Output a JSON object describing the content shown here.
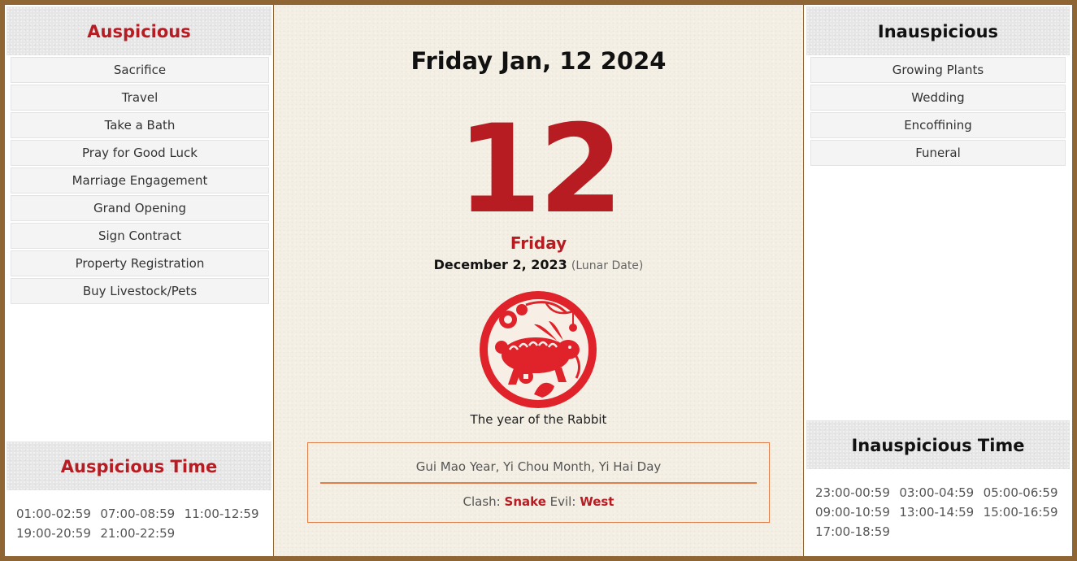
{
  "auspicious": {
    "title": "Auspicious",
    "items": [
      {
        "label": "Sacrifice"
      },
      {
        "label": "Travel"
      },
      {
        "label": "Take a Bath"
      },
      {
        "label": "Pray for Good Luck"
      },
      {
        "label": "Marriage Engagement"
      },
      {
        "label": "Grand Opening"
      },
      {
        "label": "Sign Contract"
      },
      {
        "label": "Property Registration"
      },
      {
        "label": "Buy Livestock/Pets"
      }
    ]
  },
  "auspicious_time": {
    "title": "Auspicious Time",
    "times": [
      "01:00-02:59",
      "07:00-08:59",
      "11:00-12:59",
      "19:00-20:59",
      "21:00-22:59"
    ]
  },
  "inauspicious": {
    "title": "Inauspicious",
    "items": [
      {
        "label": "Growing Plants"
      },
      {
        "label": "Wedding"
      },
      {
        "label": "Encoffining"
      },
      {
        "label": "Funeral"
      }
    ]
  },
  "inauspicious_time": {
    "title": "Inauspicious Time",
    "times": [
      "23:00-00:59",
      "03:00-04:59",
      "05:00-06:59",
      "09:00-10:59",
      "13:00-14:59",
      "15:00-16:59",
      "17:00-18:59"
    ]
  },
  "main": {
    "title": "Friday Jan, 12 2024",
    "day_number": "12",
    "weekday": "Friday",
    "lunar_date": "December 2, 2023",
    "lunar_note": "(Lunar Date)",
    "zodiac_icon": "rabbit-papercut-icon",
    "zodiac_caption": "The year of the Rabbit",
    "ganzhi": "Gui Mao Year, Yi Chou Month, Yi Hai Day",
    "clash_label": "Clash:",
    "clash_value": "Snake",
    "evil_label": "Evil:",
    "evil_value": "West"
  },
  "colors": {
    "frame": "#8f6534",
    "accent_red": "#b81c23",
    "info_border": "#e07e4c",
    "paper": "#f4efe4"
  }
}
